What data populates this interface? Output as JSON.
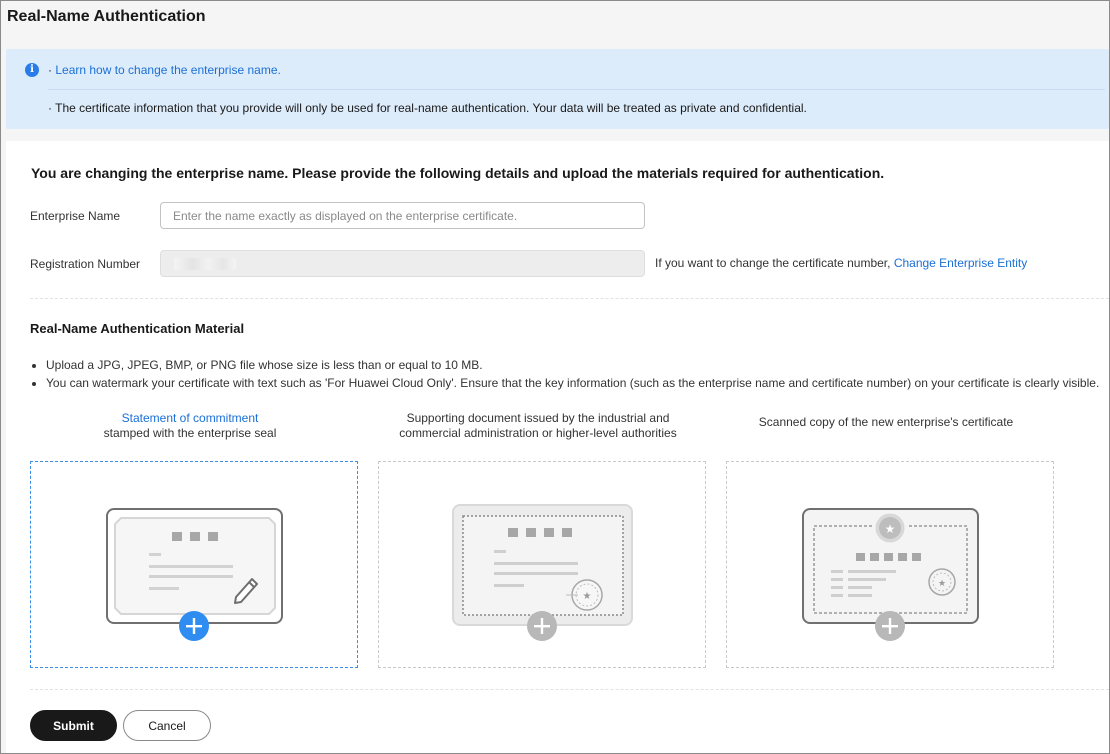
{
  "page": {
    "title": "Real-Name Authentication"
  },
  "notice": {
    "bullet1_prefix": "· ",
    "bullet1_link": "Learn how to change the enterprise name.",
    "bullet2": "· The certificate information that you provide will only be used for real-name authentication. Your data will be treated as private and confidential."
  },
  "form": {
    "heading": "You are changing the enterprise name. Please provide the following details and upload the materials required for authentication.",
    "enterprise_name": {
      "label": "Enterprise Name",
      "value": "",
      "placeholder": "Enter the name exactly as displayed on the enterprise certificate."
    },
    "registration_number": {
      "label": "Registration Number",
      "value": "",
      "hint": "If you want to change the certificate number, ",
      "hint_link": "Change Enterprise Entity"
    }
  },
  "material": {
    "heading": "Real-Name Authentication Material",
    "rules": [
      "Upload a JPG, JPEG, BMP, or PNG file whose size is less than or equal to 10 MB.",
      "You can watermark your certificate with text such as 'For Huawei Cloud Only'. Ensure that the key information (such as the enterprise name and certificate number) on your certificate is clearly visible."
    ],
    "uploads": [
      {
        "title_link": "Statement of commitment",
        "title_line2": "stamped with the enterprise seal",
        "icon": "commitment-document-icon"
      },
      {
        "title_line1": "Supporting document issued by the industrial and",
        "title_line2": "commercial administration or higher-level authorities",
        "icon": "supporting-document-icon"
      },
      {
        "title": "Scanned copy of the new enterprise's certificate",
        "icon": "enterprise-certificate-icon"
      }
    ]
  },
  "actions": {
    "submit": "Submit",
    "cancel": "Cancel"
  },
  "colors": {
    "accent": "#1a6fd6",
    "notice_bg": "#ddecfb",
    "primary_button": "#191919",
    "active_plus": "#2f8cf0",
    "inactive_plus": "#b8b8b8"
  }
}
